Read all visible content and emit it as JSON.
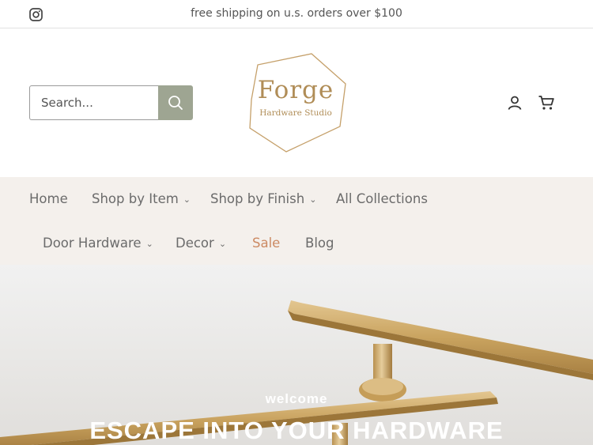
{
  "announcement": {
    "icon": "instagram-icon",
    "text": "free shipping on u.s. orders over $100"
  },
  "header": {
    "search": {
      "placeholder": "Search...",
      "button_icon": "search-icon"
    },
    "logo": {
      "word": "Forge",
      "sub": "Hardware Studio"
    },
    "account_icon": "user-icon",
    "cart_icon": "cart-icon"
  },
  "nav": {
    "items": [
      {
        "label": "Home"
      },
      {
        "label": "Shop by Item",
        "dropdown": true
      },
      {
        "label": "Shop by Finish",
        "dropdown": true
      },
      {
        "label": "All Collections"
      },
      {
        "label": "Door Hardware",
        "dropdown": true
      },
      {
        "label": "Decor",
        "dropdown": true
      },
      {
        "label": "Sale",
        "color": "#cc8a63"
      },
      {
        "label": "Blog"
      }
    ]
  },
  "hero": {
    "welcome": "welcome",
    "headline": "ESCAPE INTO YOUR HARDWARE"
  },
  "colors": {
    "search_button": "#9ea592",
    "nav_background": "#f4f0ec",
    "logo_gold": "#b08d57",
    "sale": "#cc8a63"
  }
}
